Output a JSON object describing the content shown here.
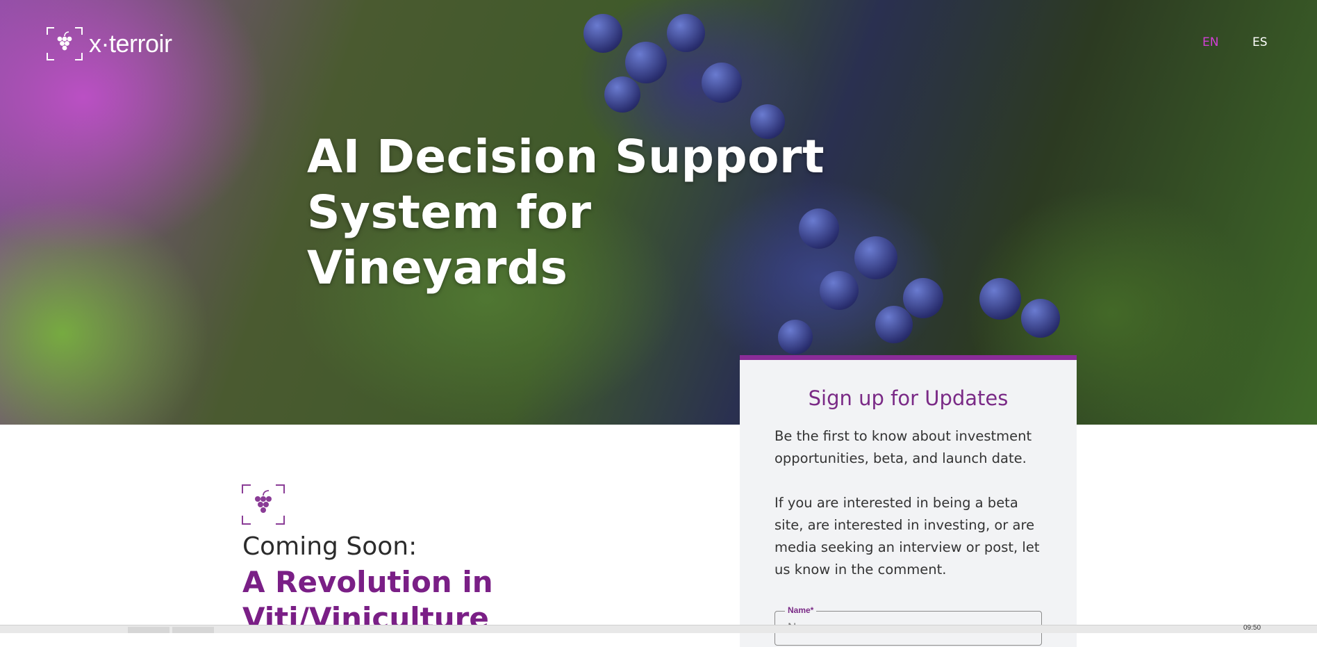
{
  "header": {
    "logo_text": "x·terroir",
    "lang_en": "EN",
    "lang_es": "ES"
  },
  "hero": {
    "headline": "AI Decision Support System for Vineyards"
  },
  "intro": {
    "coming_soon": "Coming Soon:",
    "revolution": "A Revolution in Viti/Viniculture"
  },
  "signup": {
    "title": "Sign up for Updates",
    "paragraph1": "Be the first to know about investment opportunities, beta, and launch date.",
    "paragraph2": "If you are interested in being a beta site, are interested in investing, or are media seeking an interview or post, let us know in the comment.",
    "name_label": "Name*",
    "name_placeholder": "Name"
  },
  "taskbar": {
    "time": "09:50"
  },
  "colors": {
    "accent_purple": "#7a2a86",
    "lang_active": "#d23fd6"
  },
  "icons": [
    "grape-logo-icon",
    "grape-icon"
  ]
}
